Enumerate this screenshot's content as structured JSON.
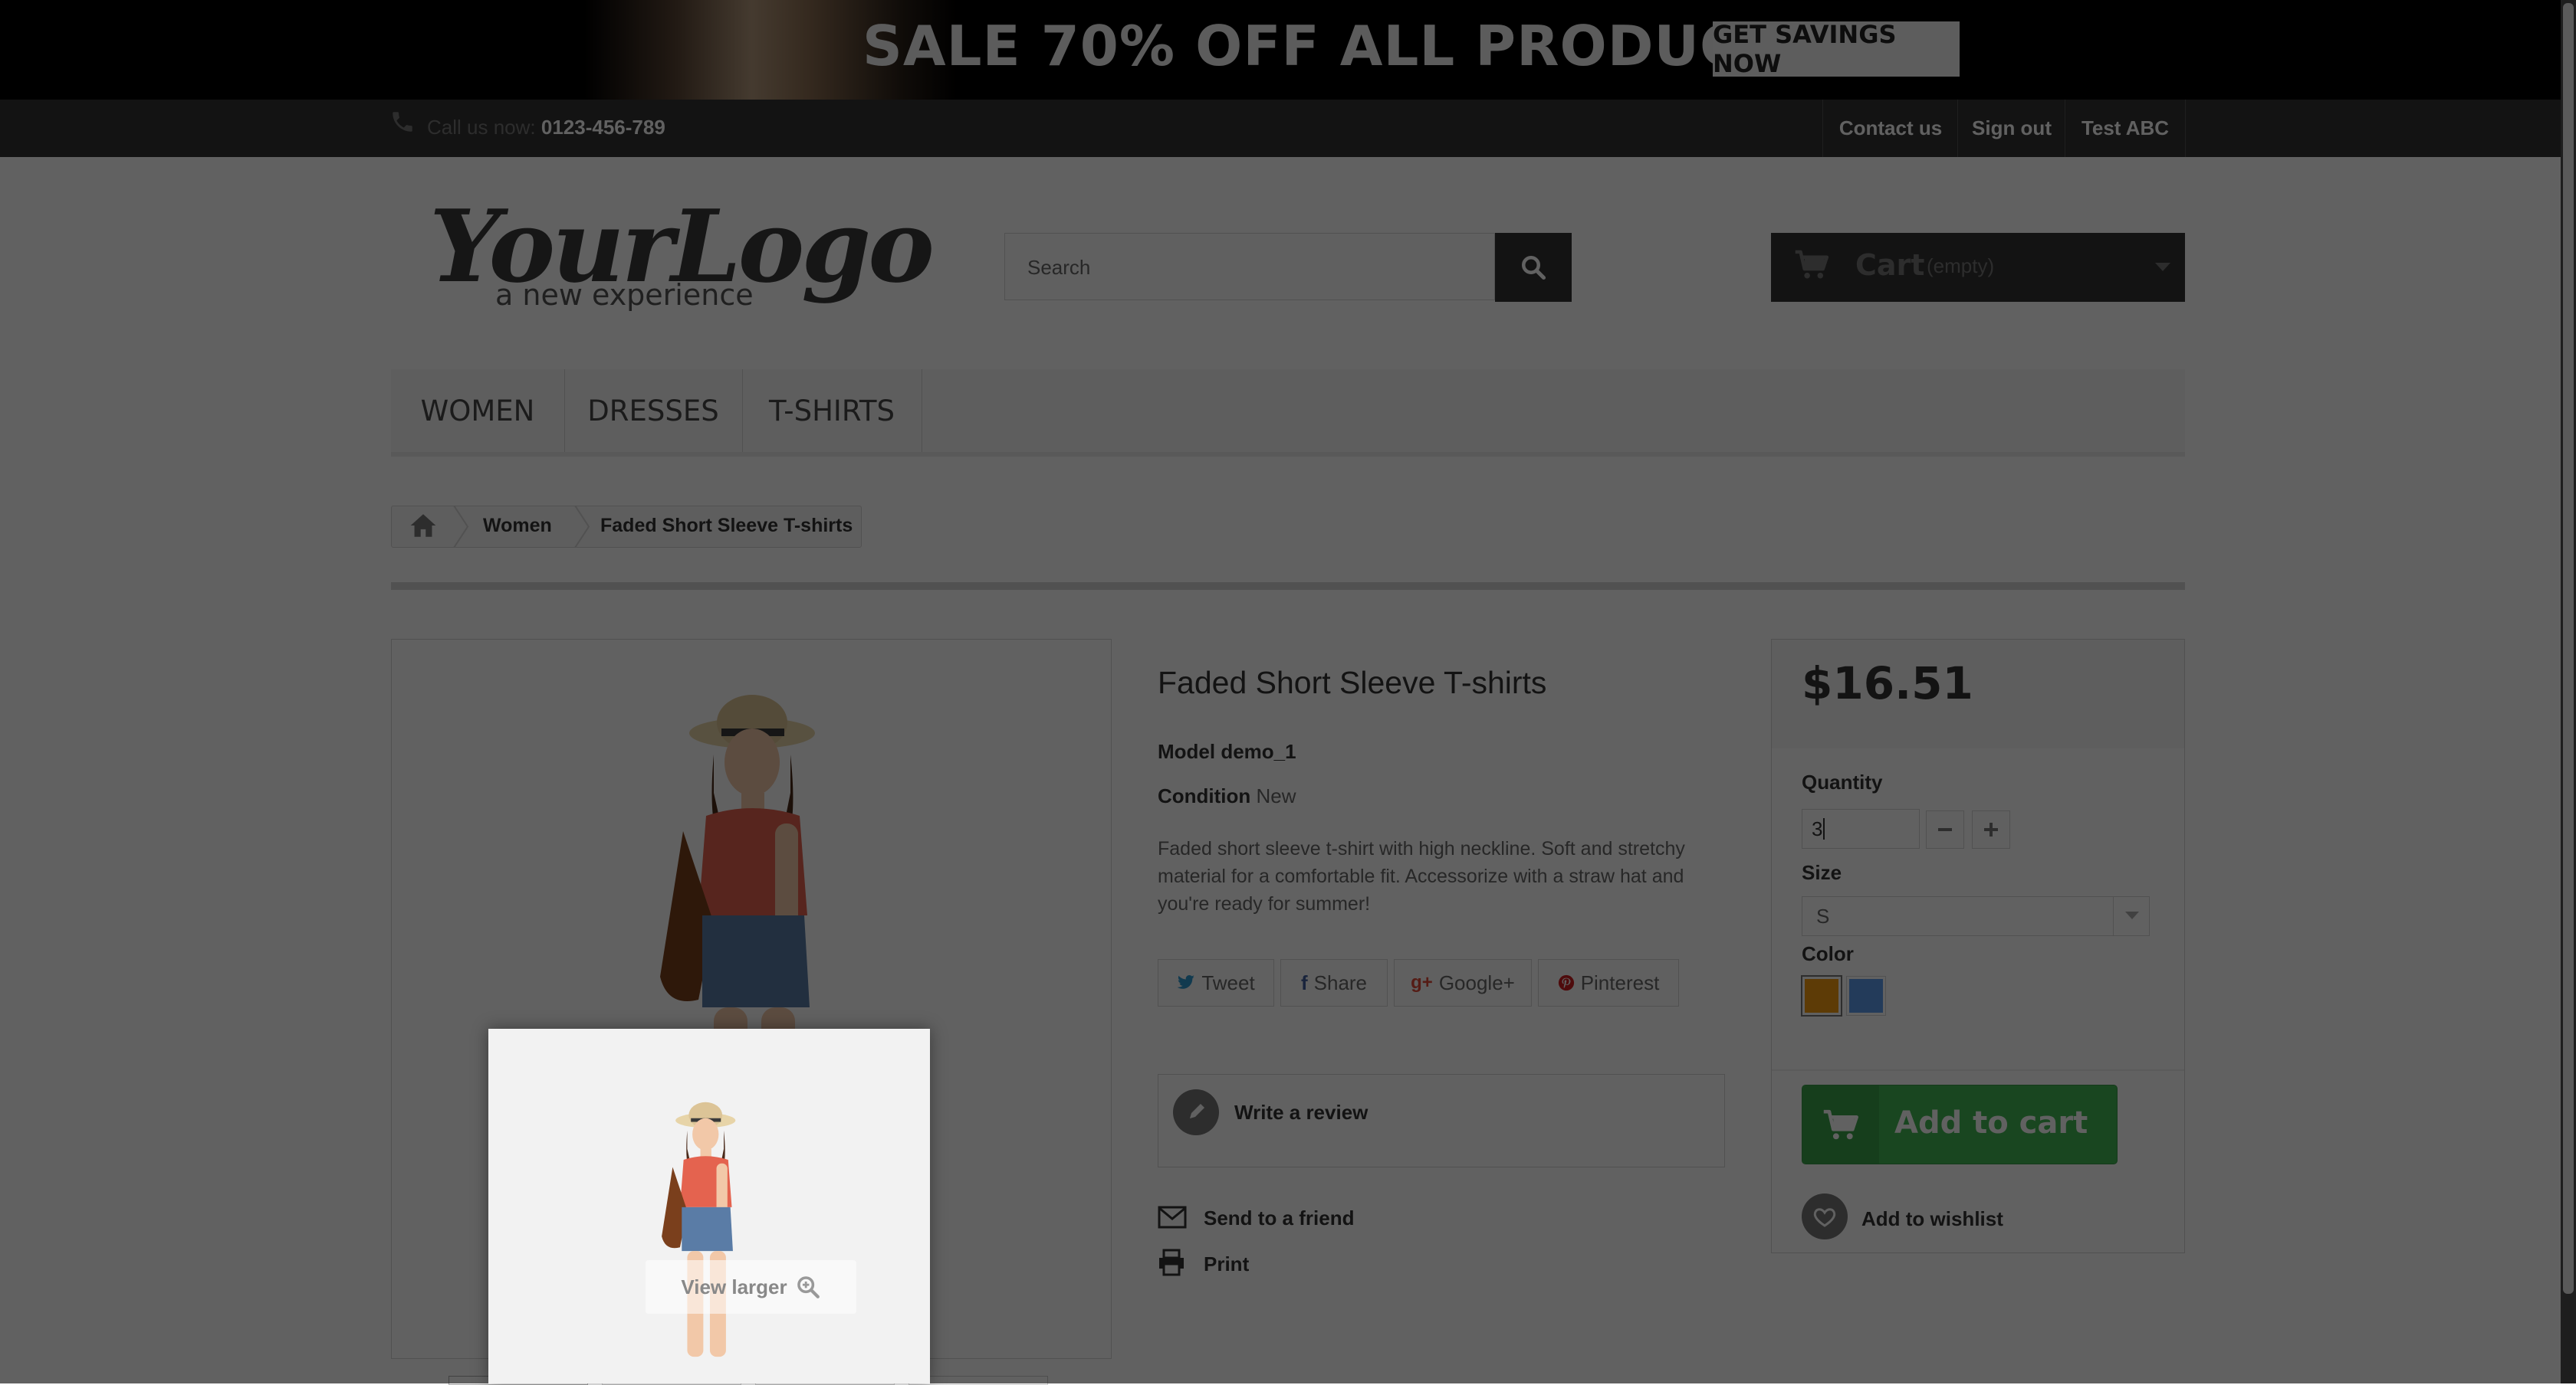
{
  "banner": {
    "headline": "SALE 70% OFF ALL PRODUCTS",
    "cta": "GET SAVINGS NOW"
  },
  "topbar": {
    "call_prefix": "Call us now:",
    "phone": "0123-456-789",
    "links": [
      "Contact us",
      "Sign out",
      "Test ABC"
    ]
  },
  "header": {
    "logo_main": "YourLogo",
    "logo_tag": "a new experience",
    "search_placeholder": "Search",
    "cart_label": "Cart",
    "cart_state": "(empty)"
  },
  "menu": [
    "WOMEN",
    "DRESSES",
    "T-SHIRTS"
  ],
  "breadcrumb": {
    "category": "Women",
    "current": "Faded Short Sleeve T-shirts"
  },
  "product": {
    "title": "Faded Short Sleeve T-shirts",
    "model_label": "Model",
    "model_value": "demo_1",
    "condition_label": "Condition",
    "condition_value": "New",
    "description": "Faded short sleeve t-shirt with high neckline. Soft and stretchy material for a comfortable fit. Accessorize with a straw hat and you're ready for summer!",
    "view_larger": "View larger",
    "social": [
      "Tweet",
      "Share",
      "Google+",
      "Pinterest"
    ],
    "write_review": "Write a review",
    "send_friend": "Send to a friend",
    "print": "Print"
  },
  "buy": {
    "price": "$16.51",
    "quantity_label": "Quantity",
    "quantity_value": "3",
    "size_label": "Size",
    "size_value": "S",
    "color_label": "Color",
    "colors": [
      "#f39c11",
      "#5d9cec"
    ],
    "add_to_cart": "Add to cart",
    "add_to_wishlist": "Add to wishlist"
  }
}
